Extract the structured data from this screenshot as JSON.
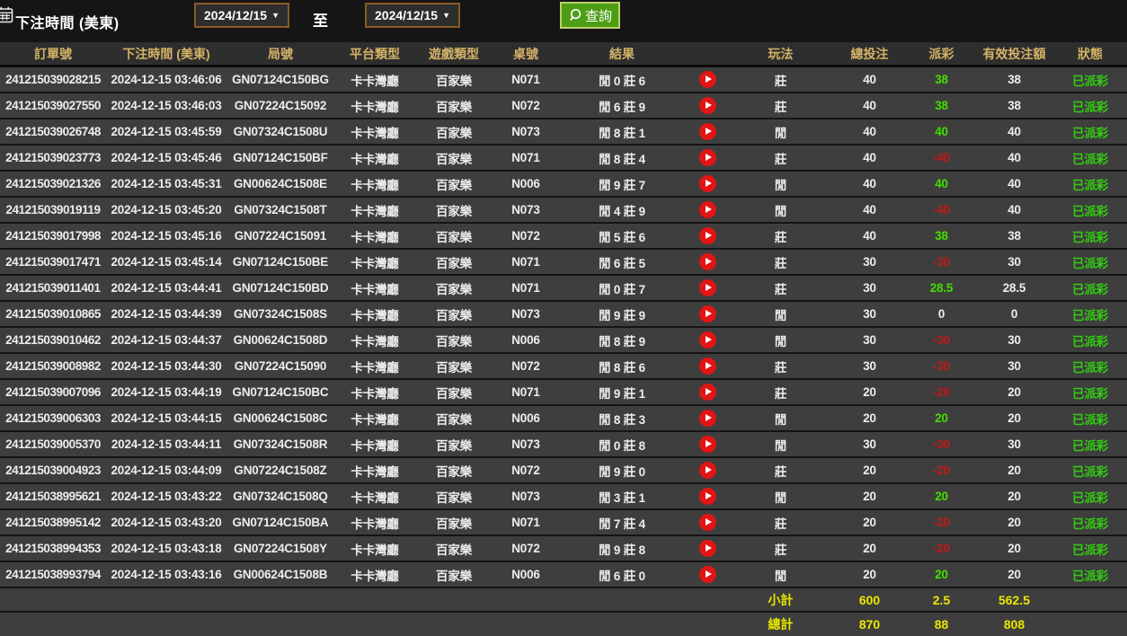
{
  "topbar": {
    "title": "下注時間 (美東)",
    "calendar_icon": "calendar-icon",
    "date_from": "2024/12/15",
    "date_to": "2024/12/15",
    "dropdown_arrow": "▼",
    "to_label": "至",
    "search_icon": "magnifier-icon",
    "search_button": "查詢"
  },
  "colors": {
    "header_text_gold": "#d4b267",
    "positive_green": "#44dd00",
    "negative_red": "#c01818",
    "status_green": "#33cc11",
    "totals_yellow": "#e8e800",
    "search_button_green": "#4d9d15",
    "dropdown_border_brown": "#8a5a22",
    "play_button_red": "#e31414",
    "row_background": "#3e3e3e"
  },
  "table": {
    "headers": [
      "訂單號",
      "下注時間 (美東)",
      "局號",
      "平台類型",
      "遊戲類型",
      "桌號",
      "結果",
      "",
      "玩法",
      "總投注",
      "派彩",
      "有效投注額",
      "狀態"
    ],
    "row_icons": {
      "play": "play-circle-icon"
    },
    "rows": [
      {
        "order": "241215039028215",
        "time": "2024-12-15 03:46:06",
        "round": "GN07124C150BG",
        "platform": "卡卡灣廳",
        "game": "百家樂",
        "table_no": "N071",
        "result": "閒 0 莊 6",
        "play": "莊",
        "total": "40",
        "payout": "38",
        "valid": "38",
        "status": "已派彩"
      },
      {
        "order": "241215039027550",
        "time": "2024-12-15 03:46:03",
        "round": "GN07224C15092",
        "platform": "卡卡灣廳",
        "game": "百家樂",
        "table_no": "N072",
        "result": "閒 6 莊 9",
        "play": "莊",
        "total": "40",
        "payout": "38",
        "valid": "38",
        "status": "已派彩"
      },
      {
        "order": "241215039026748",
        "time": "2024-12-15 03:45:59",
        "round": "GN07324C1508U",
        "platform": "卡卡灣廳",
        "game": "百家樂",
        "table_no": "N073",
        "result": "閒 8 莊 1",
        "play": "閒",
        "total": "40",
        "payout": "40",
        "valid": "40",
        "status": "已派彩"
      },
      {
        "order": "241215039023773",
        "time": "2024-12-15 03:45:46",
        "round": "GN07124C150BF",
        "platform": "卡卡灣廳",
        "game": "百家樂",
        "table_no": "N071",
        "result": "閒 8 莊 4",
        "play": "莊",
        "total": "40",
        "payout": "-40",
        "valid": "40",
        "status": "已派彩"
      },
      {
        "order": "241215039021326",
        "time": "2024-12-15 03:45:31",
        "round": "GN00624C1508E",
        "platform": "卡卡灣廳",
        "game": "百家樂",
        "table_no": "N006",
        "result": "閒 9 莊 7",
        "play": "閒",
        "total": "40",
        "payout": "40",
        "valid": "40",
        "status": "已派彩"
      },
      {
        "order": "241215039019119",
        "time": "2024-12-15 03:45:20",
        "round": "GN07324C1508T",
        "platform": "卡卡灣廳",
        "game": "百家樂",
        "table_no": "N073",
        "result": "閒 4 莊 9",
        "play": "閒",
        "total": "40",
        "payout": "-40",
        "valid": "40",
        "status": "已派彩"
      },
      {
        "order": "241215039017998",
        "time": "2024-12-15 03:45:16",
        "round": "GN07224C15091",
        "platform": "卡卡灣廳",
        "game": "百家樂",
        "table_no": "N072",
        "result": "閒 5 莊 6",
        "play": "莊",
        "total": "40",
        "payout": "38",
        "valid": "38",
        "status": "已派彩"
      },
      {
        "order": "241215039017471",
        "time": "2024-12-15 03:45:14",
        "round": "GN07124C150BE",
        "platform": "卡卡灣廳",
        "game": "百家樂",
        "table_no": "N071",
        "result": "閒 6 莊 5",
        "play": "莊",
        "total": "30",
        "payout": "-30",
        "valid": "30",
        "status": "已派彩"
      },
      {
        "order": "241215039011401",
        "time": "2024-12-15 03:44:41",
        "round": "GN07124C150BD",
        "platform": "卡卡灣廳",
        "game": "百家樂",
        "table_no": "N071",
        "result": "閒 0 莊 7",
        "play": "莊",
        "total": "30",
        "payout": "28.5",
        "valid": "28.5",
        "status": "已派彩"
      },
      {
        "order": "241215039010865",
        "time": "2024-12-15 03:44:39",
        "round": "GN07324C1508S",
        "platform": "卡卡灣廳",
        "game": "百家樂",
        "table_no": "N073",
        "result": "閒 9 莊 9",
        "play": "閒",
        "total": "30",
        "payout": "0",
        "valid": "0",
        "status": "已派彩"
      },
      {
        "order": "241215039010462",
        "time": "2024-12-15 03:44:37",
        "round": "GN00624C1508D",
        "platform": "卡卡灣廳",
        "game": "百家樂",
        "table_no": "N006",
        "result": "閒 8 莊 9",
        "play": "閒",
        "total": "30",
        "payout": "-30",
        "valid": "30",
        "status": "已派彩"
      },
      {
        "order": "241215039008982",
        "time": "2024-12-15 03:44:30",
        "round": "GN07224C15090",
        "platform": "卡卡灣廳",
        "game": "百家樂",
        "table_no": "N072",
        "result": "閒 8 莊 6",
        "play": "莊",
        "total": "30",
        "payout": "-30",
        "valid": "30",
        "status": "已派彩"
      },
      {
        "order": "241215039007096",
        "time": "2024-12-15 03:44:19",
        "round": "GN07124C150BC",
        "platform": "卡卡灣廳",
        "game": "百家樂",
        "table_no": "N071",
        "result": "閒 9 莊 1",
        "play": "莊",
        "total": "20",
        "payout": "-20",
        "valid": "20",
        "status": "已派彩"
      },
      {
        "order": "241215039006303",
        "time": "2024-12-15 03:44:15",
        "round": "GN00624C1508C",
        "platform": "卡卡灣廳",
        "game": "百家樂",
        "table_no": "N006",
        "result": "閒 8 莊 3",
        "play": "閒",
        "total": "20",
        "payout": "20",
        "valid": "20",
        "status": "已派彩"
      },
      {
        "order": "241215039005370",
        "time": "2024-12-15 03:44:11",
        "round": "GN07324C1508R",
        "platform": "卡卡灣廳",
        "game": "百家樂",
        "table_no": "N073",
        "result": "閒 0 莊 8",
        "play": "閒",
        "total": "30",
        "payout": "-30",
        "valid": "30",
        "status": "已派彩"
      },
      {
        "order": "241215039004923",
        "time": "2024-12-15 03:44:09",
        "round": "GN07224C1508Z",
        "platform": "卡卡灣廳",
        "game": "百家樂",
        "table_no": "N072",
        "result": "閒 9 莊 0",
        "play": "莊",
        "total": "20",
        "payout": "-20",
        "valid": "20",
        "status": "已派彩"
      },
      {
        "order": "241215038995621",
        "time": "2024-12-15 03:43:22",
        "round": "GN07324C1508Q",
        "platform": "卡卡灣廳",
        "game": "百家樂",
        "table_no": "N073",
        "result": "閒 3 莊 1",
        "play": "閒",
        "total": "20",
        "payout": "20",
        "valid": "20",
        "status": "已派彩"
      },
      {
        "order": "241215038995142",
        "time": "2024-12-15 03:43:20",
        "round": "GN07124C150BA",
        "platform": "卡卡灣廳",
        "game": "百家樂",
        "table_no": "N071",
        "result": "閒 7 莊 4",
        "play": "莊",
        "total": "20",
        "payout": "-20",
        "valid": "20",
        "status": "已派彩"
      },
      {
        "order": "241215038994353",
        "time": "2024-12-15 03:43:18",
        "round": "GN07224C1508Y",
        "platform": "卡卡灣廳",
        "game": "百家樂",
        "table_no": "N072",
        "result": "閒 9 莊 8",
        "play": "莊",
        "total": "20",
        "payout": "-20",
        "valid": "20",
        "status": "已派彩"
      },
      {
        "order": "241215038993794",
        "time": "2024-12-15 03:43:16",
        "round": "GN00624C1508B",
        "platform": "卡卡灣廳",
        "game": "百家樂",
        "table_no": "N006",
        "result": "閒 6 莊 0",
        "play": "閒",
        "total": "20",
        "payout": "20",
        "valid": "20",
        "status": "已派彩"
      }
    ],
    "subtotal": {
      "label": "小計",
      "total": "600",
      "payout": "2.5",
      "valid": "562.5"
    },
    "grand_total": {
      "label": "總計",
      "total": "870",
      "payout": "88",
      "valid": "808"
    }
  }
}
